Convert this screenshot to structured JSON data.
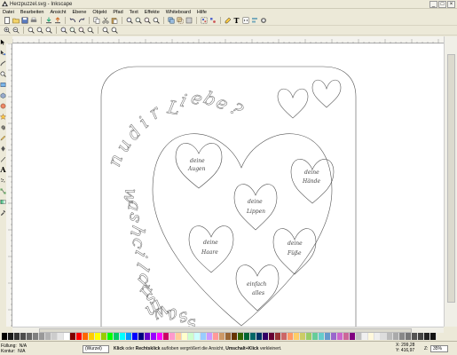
{
  "window": {
    "title": "Herzpuzzel.svg - Inkscape"
  },
  "menu": [
    "Datei",
    "Bearbeiten",
    "Ansicht",
    "Ebene",
    "Objekt",
    "Pfad",
    "Text",
    "Effekte",
    "Whiteboard",
    "Hilfe"
  ],
  "canvas_text": {
    "curve_letters": [
      "n",
      "u",
      "d",
      "i",
      "r",
      "L",
      "i",
      "e",
      "b",
      "e",
      "?"
    ],
    "left_letters": [
      "w",
      "a",
      "s",
      "h",
      "c",
      "i",
      "l",
      "d",
      "u",
      "s",
      "m",
      "w",
      "a",
      "s",
      "s"
    ],
    "hearts": [
      {
        "line1": "deine",
        "line2": "Augen"
      },
      {
        "line1": "deine",
        "line2": "Hände"
      },
      {
        "line1": "deine",
        "line2": "Lippen"
      },
      {
        "line1": "deine",
        "line2": "Haare"
      },
      {
        "line1": "deine",
        "line2": "Füße"
      },
      {
        "line1": "einfach",
        "line2": "alles"
      }
    ]
  },
  "status": {
    "fill_label": "Füllung:",
    "fill_value": "N/A",
    "stroke_label": "Kontur:",
    "stroke_value": "N/A",
    "layer": "(Wurzel)",
    "hint_bold1": "Klick",
    "hint_text1": " oder ",
    "hint_bold2": "Rechtsklick",
    "hint_text2": " auf/oben vergrößert die Ansicht, ",
    "hint_bold3": "Umschalt+Klick",
    "hint_text3": " verkleinert.",
    "x_label": "X:",
    "x_value": "299,28",
    "y_label": "Y:",
    "y_value": "416,97",
    "z_label": "Z:",
    "zoom": "35%"
  },
  "palette_colors": [
    "#000000",
    "#1a1a1a",
    "#333333",
    "#4d4d4d",
    "#666666",
    "#808080",
    "#999999",
    "#b3b3b3",
    "#cccccc",
    "#e6e6e6",
    "#ffffff",
    "#800000",
    "#ff0000",
    "#ff6600",
    "#ffcc00",
    "#ffff00",
    "#99cc00",
    "#00ff00",
    "#00cc66",
    "#00ffff",
    "#0099ff",
    "#0000ff",
    "#000080",
    "#6600cc",
    "#9900ff",
    "#ff00ff",
    "#cc0066",
    "#ff99cc",
    "#ffcc99",
    "#ffffcc",
    "#ccffcc",
    "#ccffff",
    "#99ccff",
    "#cc99ff",
    "#ff9999",
    "#cc9966",
    "#996633",
    "#663300",
    "#336600",
    "#006633",
    "#006666",
    "#003366",
    "#330066",
    "#660033",
    "#993333",
    "#cc6666",
    "#ff9966",
    "#ffcc66",
    "#cccc66",
    "#99cc66",
    "#66cc99",
    "#66cccc",
    "#6699cc",
    "#9966cc",
    "#cc66cc",
    "#cc6699",
    "#800080",
    "#c0c0c0",
    "#f0f0f0",
    "#fff8dc",
    "#eeeeee",
    "#dddddd",
    "#bbbbbb",
    "#aaaaaa",
    "#888888",
    "#777777",
    "#555555",
    "#444444",
    "#222222",
    "#111111"
  ]
}
